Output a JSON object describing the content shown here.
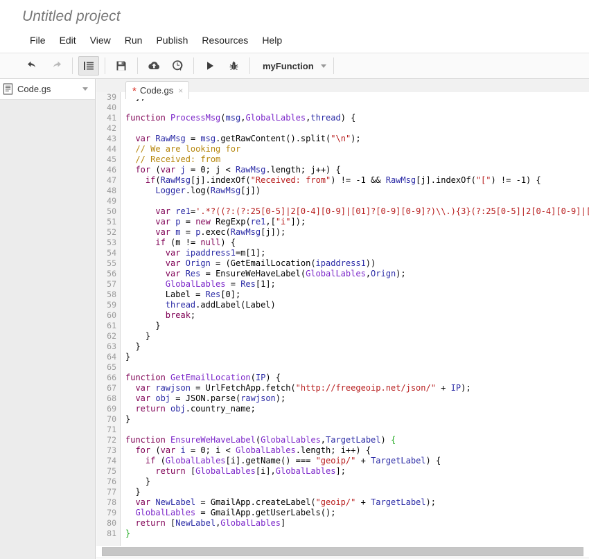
{
  "window": {
    "project_title": "Untitled project"
  },
  "menu": {
    "items": [
      {
        "label": "File"
      },
      {
        "label": "Edit"
      },
      {
        "label": "View"
      },
      {
        "label": "Run"
      },
      {
        "label": "Publish"
      },
      {
        "label": "Resources"
      },
      {
        "label": "Help"
      }
    ]
  },
  "toolbar": {
    "buttons": [
      {
        "name": "undo-icon",
        "tooltip": "Undo"
      },
      {
        "name": "redo-icon",
        "tooltip": "Redo"
      },
      {
        "name": "indent-icon",
        "tooltip": "Indent"
      },
      {
        "name": "save-icon",
        "tooltip": "Save"
      },
      {
        "name": "cloud-upload-icon",
        "tooltip": "Publish"
      },
      {
        "name": "history-clock-icon",
        "tooltip": "Version history"
      },
      {
        "name": "run-icon",
        "tooltip": "Run"
      },
      {
        "name": "debug-bug-icon",
        "tooltip": "Debug"
      }
    ],
    "function_selector": {
      "value": "myFunction",
      "caret": "chevron-down-icon"
    }
  },
  "sidebar": {
    "files": [
      {
        "icon": "script-file-icon",
        "name": "Code.gs",
        "caret": "chevron-down-icon"
      }
    ]
  },
  "tabs": [
    {
      "dirty_marker": "*",
      "label": "Code.gs",
      "close": "×",
      "active": true
    }
  ],
  "editor": {
    "first_visible_line": 39,
    "lines": [
      {
        "num": 39,
        "tokens": [
          {
            "t": "  };",
            "c": "n"
          }
        ]
      },
      {
        "num": 40,
        "tokens": []
      },
      {
        "num": 41,
        "tokens": [
          {
            "t": "function ",
            "c": "k"
          },
          {
            "t": "ProcessMsg",
            "c": "p"
          },
          {
            "t": "(",
            "c": "n"
          },
          {
            "t": "msg",
            "c": "id"
          },
          {
            "t": ",",
            "c": "n"
          },
          {
            "t": "GlobalLables",
            "c": "p"
          },
          {
            "t": ",",
            "c": "n"
          },
          {
            "t": "thread",
            "c": "id"
          },
          {
            "t": ") {",
            "c": "n"
          }
        ]
      },
      {
        "num": 42,
        "tokens": []
      },
      {
        "num": 43,
        "tokens": [
          {
            "t": "  ",
            "c": "n"
          },
          {
            "t": "var ",
            "c": "k"
          },
          {
            "t": "RawMsg",
            "c": "id"
          },
          {
            "t": " = ",
            "c": "n"
          },
          {
            "t": "msg",
            "c": "id"
          },
          {
            "t": ".getRawContent().split(",
            "c": "n"
          },
          {
            "t": "\"\\n\"",
            "c": "s"
          },
          {
            "t": ");",
            "c": "n"
          }
        ]
      },
      {
        "num": 44,
        "tokens": [
          {
            "t": "  // We are looking for",
            "c": "c"
          }
        ]
      },
      {
        "num": 45,
        "tokens": [
          {
            "t": "  // Received: from",
            "c": "c"
          }
        ]
      },
      {
        "num": 46,
        "tokens": [
          {
            "t": "  ",
            "c": "n"
          },
          {
            "t": "for ",
            "c": "k"
          },
          {
            "t": "(",
            "c": "n"
          },
          {
            "t": "var ",
            "c": "k"
          },
          {
            "t": "j",
            "c": "id"
          },
          {
            "t": " = 0; j < ",
            "c": "n"
          },
          {
            "t": "RawMsg",
            "c": "id"
          },
          {
            "t": ".length; j++) {",
            "c": "n"
          }
        ]
      },
      {
        "num": 47,
        "tokens": [
          {
            "t": "    ",
            "c": "n"
          },
          {
            "t": "if",
            "c": "k"
          },
          {
            "t": "(",
            "c": "n"
          },
          {
            "t": "RawMsg",
            "c": "id"
          },
          {
            "t": "[j].indexOf(",
            "c": "n"
          },
          {
            "t": "\"Received: from\"",
            "c": "s"
          },
          {
            "t": ") != -1 && ",
            "c": "n"
          },
          {
            "t": "RawMsg",
            "c": "id"
          },
          {
            "t": "[j].indexOf(",
            "c": "n"
          },
          {
            "t": "\"[\"",
            "c": "s"
          },
          {
            "t": ") != -1) {",
            "c": "n"
          }
        ]
      },
      {
        "num": 48,
        "tokens": [
          {
            "t": "      ",
            "c": "n"
          },
          {
            "t": "Logger",
            "c": "id"
          },
          {
            "t": ".log(",
            "c": "n"
          },
          {
            "t": "RawMsg",
            "c": "id"
          },
          {
            "t": "[j])",
            "c": "n"
          }
        ]
      },
      {
        "num": 49,
        "tokens": []
      },
      {
        "num": 50,
        "tokens": [
          {
            "t": "      ",
            "c": "n"
          },
          {
            "t": "var ",
            "c": "k"
          },
          {
            "t": "re1",
            "c": "id"
          },
          {
            "t": "=",
            "c": "n"
          },
          {
            "t": "'.*?((?:(?:25[0-5]|2[0-4][0-9]|[01]?[0-9][0-9]?)\\\\.){3}(?:25[0-5]|2[0-4][0-9]|[0",
            "c": "s"
          }
        ]
      },
      {
        "num": 51,
        "tokens": [
          {
            "t": "      ",
            "c": "n"
          },
          {
            "t": "var ",
            "c": "k"
          },
          {
            "t": "p",
            "c": "id"
          },
          {
            "t": " = ",
            "c": "n"
          },
          {
            "t": "new ",
            "c": "k"
          },
          {
            "t": "RegExp(",
            "c": "n"
          },
          {
            "t": "re1",
            "c": "id"
          },
          {
            "t": ",[",
            "c": "n"
          },
          {
            "t": "\"i\"",
            "c": "s"
          },
          {
            "t": "]);",
            "c": "n"
          }
        ]
      },
      {
        "num": 52,
        "tokens": [
          {
            "t": "      ",
            "c": "n"
          },
          {
            "t": "var ",
            "c": "k"
          },
          {
            "t": "m",
            "c": "id"
          },
          {
            "t": " = ",
            "c": "n"
          },
          {
            "t": "p",
            "c": "id"
          },
          {
            "t": ".exec(",
            "c": "n"
          },
          {
            "t": "RawMsg",
            "c": "id"
          },
          {
            "t": "[j]);",
            "c": "n"
          }
        ]
      },
      {
        "num": 53,
        "tokens": [
          {
            "t": "      ",
            "c": "n"
          },
          {
            "t": "if ",
            "c": "k"
          },
          {
            "t": "(m != ",
            "c": "n"
          },
          {
            "t": "null",
            "c": "k"
          },
          {
            "t": ") {",
            "c": "n"
          }
        ]
      },
      {
        "num": 54,
        "tokens": [
          {
            "t": "        ",
            "c": "n"
          },
          {
            "t": "var ",
            "c": "k"
          },
          {
            "t": "ipaddress1",
            "c": "id"
          },
          {
            "t": "=m[1];",
            "c": "n"
          }
        ]
      },
      {
        "num": 55,
        "tokens": [
          {
            "t": "        ",
            "c": "n"
          },
          {
            "t": "var ",
            "c": "k"
          },
          {
            "t": "Orign",
            "c": "id"
          },
          {
            "t": " = (GetEmailLocation(",
            "c": "n"
          },
          {
            "t": "ipaddress1",
            "c": "id"
          },
          {
            "t": "))",
            "c": "n"
          }
        ]
      },
      {
        "num": 56,
        "tokens": [
          {
            "t": "        ",
            "c": "n"
          },
          {
            "t": "var ",
            "c": "k"
          },
          {
            "t": "Res",
            "c": "id"
          },
          {
            "t": " = EnsureWeHaveLabel(",
            "c": "n"
          },
          {
            "t": "GlobalLables",
            "c": "p"
          },
          {
            "t": ",",
            "c": "n"
          },
          {
            "t": "Orign",
            "c": "id"
          },
          {
            "t": ");",
            "c": "n"
          }
        ]
      },
      {
        "num": 57,
        "tokens": [
          {
            "t": "        ",
            "c": "n"
          },
          {
            "t": "GlobalLables",
            "c": "p"
          },
          {
            "t": " = ",
            "c": "n"
          },
          {
            "t": "Res",
            "c": "id"
          },
          {
            "t": "[1];",
            "c": "n"
          }
        ]
      },
      {
        "num": 58,
        "tokens": [
          {
            "t": "        Label = ",
            "c": "n"
          },
          {
            "t": "Res",
            "c": "id"
          },
          {
            "t": "[0];",
            "c": "n"
          }
        ]
      },
      {
        "num": 59,
        "tokens": [
          {
            "t": "        ",
            "c": "n"
          },
          {
            "t": "thread",
            "c": "id"
          },
          {
            "t": ".addLabel(Label)",
            "c": "n"
          }
        ]
      },
      {
        "num": 60,
        "tokens": [
          {
            "t": "        ",
            "c": "n"
          },
          {
            "t": "break",
            "c": "k"
          },
          {
            "t": ";",
            "c": "n"
          }
        ]
      },
      {
        "num": 61,
        "tokens": [
          {
            "t": "      }",
            "c": "n"
          }
        ]
      },
      {
        "num": 62,
        "tokens": [
          {
            "t": "    }",
            "c": "n"
          }
        ]
      },
      {
        "num": 63,
        "tokens": [
          {
            "t": "  }",
            "c": "n"
          }
        ]
      },
      {
        "num": 64,
        "tokens": [
          {
            "t": "}",
            "c": "n"
          }
        ]
      },
      {
        "num": 65,
        "tokens": []
      },
      {
        "num": 66,
        "tokens": [
          {
            "t": "function ",
            "c": "k"
          },
          {
            "t": "GetEmailLocation",
            "c": "p"
          },
          {
            "t": "(",
            "c": "n"
          },
          {
            "t": "IP",
            "c": "id"
          },
          {
            "t": ") {",
            "c": "n"
          }
        ]
      },
      {
        "num": 67,
        "tokens": [
          {
            "t": "  ",
            "c": "n"
          },
          {
            "t": "var ",
            "c": "k"
          },
          {
            "t": "rawjson",
            "c": "id"
          },
          {
            "t": " = UrlFetchApp.fetch(",
            "c": "n"
          },
          {
            "t": "\"http://freegeoip.net/json/\"",
            "c": "s"
          },
          {
            "t": " + ",
            "c": "n"
          },
          {
            "t": "IP",
            "c": "id"
          },
          {
            "t": ");",
            "c": "n"
          }
        ]
      },
      {
        "num": 68,
        "tokens": [
          {
            "t": "  ",
            "c": "n"
          },
          {
            "t": "var ",
            "c": "k"
          },
          {
            "t": "obj",
            "c": "id"
          },
          {
            "t": " = JSON.parse(",
            "c": "n"
          },
          {
            "t": "rawjson",
            "c": "id"
          },
          {
            "t": ");",
            "c": "n"
          }
        ]
      },
      {
        "num": 69,
        "tokens": [
          {
            "t": "  ",
            "c": "n"
          },
          {
            "t": "return ",
            "c": "k"
          },
          {
            "t": "obj",
            "c": "id"
          },
          {
            "t": ".country_name;",
            "c": "n"
          }
        ]
      },
      {
        "num": 70,
        "tokens": [
          {
            "t": "}",
            "c": "n"
          }
        ]
      },
      {
        "num": 71,
        "tokens": []
      },
      {
        "num": 72,
        "tokens": [
          {
            "t": "function ",
            "c": "k"
          },
          {
            "t": "EnsureWeHaveLabel",
            "c": "p"
          },
          {
            "t": "(",
            "c": "n"
          },
          {
            "t": "GlobalLables",
            "c": "p"
          },
          {
            "t": ",",
            "c": "n"
          },
          {
            "t": "TargetLabel",
            "c": "id"
          },
          {
            "t": ") ",
            "c": "n"
          },
          {
            "t": "{",
            "c": "g"
          }
        ]
      },
      {
        "num": 73,
        "tokens": [
          {
            "t": "  ",
            "c": "n"
          },
          {
            "t": "for ",
            "c": "k"
          },
          {
            "t": "(",
            "c": "n"
          },
          {
            "t": "var ",
            "c": "k"
          },
          {
            "t": "i",
            "c": "id"
          },
          {
            "t": " = 0; i < ",
            "c": "n"
          },
          {
            "t": "GlobalLables",
            "c": "p"
          },
          {
            "t": ".length; i++) {",
            "c": "n"
          }
        ]
      },
      {
        "num": 74,
        "tokens": [
          {
            "t": "    ",
            "c": "n"
          },
          {
            "t": "if ",
            "c": "k"
          },
          {
            "t": "(",
            "c": "n"
          },
          {
            "t": "GlobalLables",
            "c": "p"
          },
          {
            "t": "[i].getName() === ",
            "c": "n"
          },
          {
            "t": "\"geoip/\"",
            "c": "s"
          },
          {
            "t": " + ",
            "c": "n"
          },
          {
            "t": "TargetLabel",
            "c": "id"
          },
          {
            "t": ") {",
            "c": "n"
          }
        ]
      },
      {
        "num": 75,
        "tokens": [
          {
            "t": "      ",
            "c": "n"
          },
          {
            "t": "return ",
            "c": "k"
          },
          {
            "t": "[",
            "c": "n"
          },
          {
            "t": "GlobalLables",
            "c": "p"
          },
          {
            "t": "[i],",
            "c": "n"
          },
          {
            "t": "GlobalLables",
            "c": "p"
          },
          {
            "t": "];",
            "c": "n"
          }
        ]
      },
      {
        "num": 76,
        "tokens": [
          {
            "t": "    }",
            "c": "n"
          }
        ]
      },
      {
        "num": 77,
        "tokens": [
          {
            "t": "  }",
            "c": "n"
          }
        ]
      },
      {
        "num": 78,
        "tokens": [
          {
            "t": "  ",
            "c": "n"
          },
          {
            "t": "var ",
            "c": "k"
          },
          {
            "t": "NewLabel",
            "c": "id"
          },
          {
            "t": " = GmailApp.createLabel(",
            "c": "n"
          },
          {
            "t": "\"geoip/\"",
            "c": "s"
          },
          {
            "t": " + ",
            "c": "n"
          },
          {
            "t": "TargetLabel",
            "c": "id"
          },
          {
            "t": ");",
            "c": "n"
          }
        ]
      },
      {
        "num": 79,
        "tokens": [
          {
            "t": "  ",
            "c": "n"
          },
          {
            "t": "GlobalLables",
            "c": "p"
          },
          {
            "t": " = GmailApp.getUserLabels();",
            "c": "n"
          }
        ]
      },
      {
        "num": 80,
        "tokens": [
          {
            "t": "  ",
            "c": "n"
          },
          {
            "t": "return ",
            "c": "k"
          },
          {
            "t": "[",
            "c": "n"
          },
          {
            "t": "NewLabel",
            "c": "id"
          },
          {
            "t": ",",
            "c": "n"
          },
          {
            "t": "GlobalLables",
            "c": "p"
          },
          {
            "t": "]",
            "c": "n"
          }
        ]
      },
      {
        "num": 81,
        "tokens": [
          {
            "t": "}",
            "c": "g"
          }
        ]
      }
    ]
  },
  "scrollbar": {
    "orientation": "horizontal",
    "thumb_percent": 100
  },
  "colors": {
    "keyword": "#7f0055",
    "identifier": "#2a2aa5",
    "parameter": "#7b26c9",
    "string": "#b71c1c",
    "comment": "#b5850b",
    "brace_match": "#22aa22",
    "gutter_bg": "#f3f3f3",
    "sidebar_bg": "#ececec",
    "tabstrip_bg": "#f1f1f1",
    "toolbar_bg": "#fafafa"
  }
}
